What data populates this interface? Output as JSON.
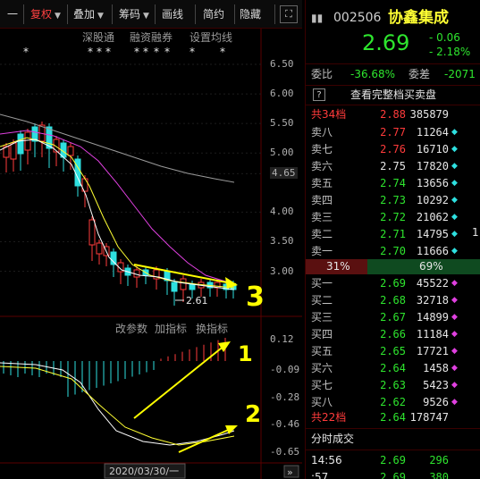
{
  "toolbar": {
    "items": [
      {
        "label": "一"
      },
      {
        "label": "复权"
      },
      {
        "label": "叠加"
      },
      {
        "label": "筹码"
      },
      {
        "label": "画线"
      },
      {
        "label": "简约"
      },
      {
        "label": "隐藏"
      }
    ],
    "expand_glyph": "⛶"
  },
  "chart_links": [
    "深股通",
    "融资融券",
    "设置均线"
  ],
  "y_axis": [
    "6.50",
    "6.00",
    "5.50",
    "5.00",
    "4.65",
    "4.00",
    "3.50",
    "3.00"
  ],
  "low_marker": "2.61",
  "indicator_bar": [
    "改参数",
    "加指标",
    "换指标"
  ],
  "macd_axis": [
    "0.12",
    "-0.09",
    "-0.28",
    "-0.46",
    "-0.65"
  ],
  "date_label": "2020/03/30/一",
  "scroll_glyph": "»",
  "annotations": [
    "3",
    "1",
    "2"
  ],
  "chart_data": {
    "type": "line",
    "title": "",
    "xlabel": "",
    "ylabel": "",
    "ylim": [
      2.6,
      6.5
    ],
    "y_ticks": [
      6.5,
      6.0,
      5.5,
      5.0,
      4.65,
      4.0,
      3.5,
      3.0
    ],
    "series": [],
    "macd_ylim": [
      -0.65,
      0.12
    ],
    "macd_ticks": [
      0.12,
      -0.09,
      -0.28,
      -0.46,
      -0.65
    ],
    "low_label": 2.61
  },
  "quote": {
    "code": "002506",
    "name": "协鑫集成",
    "price": "2.69",
    "change": "- 0.06",
    "change_pct": "- 2.18%",
    "weibi_label": "委比",
    "weibi": "-36.68%",
    "weicha_label": "委差",
    "weicha": "-2071",
    "help_glyph": "?",
    "full_book": "查看完整档买卖盘",
    "total_sell_label": "共34档",
    "total_sell_price": "2.88",
    "total_sell_vol": "385879",
    "sell": [
      {
        "label": "卖八",
        "price": "2.77",
        "vol": "11264",
        "mark": "◆",
        "color": "red"
      },
      {
        "label": "卖七",
        "price": "2.76",
        "vol": "16710",
        "mark": "◆",
        "color": "red"
      },
      {
        "label": "卖六",
        "price": "2.75",
        "vol": "17820",
        "mark": "◆",
        "color": "white"
      },
      {
        "label": "卖五",
        "price": "2.74",
        "vol": "13656",
        "mark": "◆",
        "color": "green"
      },
      {
        "label": "卖四",
        "price": "2.73",
        "vol": "10292",
        "mark": "◆",
        "color": "green"
      },
      {
        "label": "卖三",
        "price": "2.72",
        "vol": "21062",
        "mark": "◆",
        "color": "green"
      },
      {
        "label": "卖二",
        "price": "2.71",
        "vol": "14795",
        "mark": "◆",
        "color": "green"
      },
      {
        "label": "卖一",
        "price": "2.70",
        "vol": "11666",
        "mark": "◆",
        "color": "green"
      }
    ],
    "sell_extra": "1",
    "ratio_left": "31%",
    "ratio_right": "69%",
    "buy": [
      {
        "label": "买一",
        "price": "2.69",
        "vol": "45522",
        "mark": "◆",
        "color": "green"
      },
      {
        "label": "买二",
        "price": "2.68",
        "vol": "32718",
        "mark": "◆",
        "color": "green"
      },
      {
        "label": "买三",
        "price": "2.67",
        "vol": "14899",
        "mark": "◆",
        "color": "green"
      },
      {
        "label": "买四",
        "price": "2.66",
        "vol": "11184",
        "mark": "◆",
        "color": "green"
      },
      {
        "label": "买五",
        "price": "2.65",
        "vol": "17721",
        "mark": "◆",
        "color": "green"
      },
      {
        "label": "买六",
        "price": "2.64",
        "vol": "1458",
        "mark": "◆",
        "color": "green"
      },
      {
        "label": "买七",
        "price": "2.63",
        "vol": "5423",
        "mark": "◆",
        "color": "green"
      },
      {
        "label": "买八",
        "price": "2.62",
        "vol": "9526",
        "mark": "◆",
        "color": "green"
      }
    ],
    "total_buy_label": "共22档",
    "total_buy_price": "2.64",
    "total_buy_vol": "178747",
    "timeshare_title": "分时成交",
    "ticks": [
      {
        "time": "14:56",
        "price": "2.69",
        "vol": "296"
      },
      {
        "time": ":57",
        "price": "2.69",
        "vol": "380"
      }
    ]
  },
  "colors": {
    "up": "#ff3b3b",
    "down": "#2ee52e",
    "ma5": "#ffffff",
    "ma10": "#ffff33",
    "ma20": "#e040e0",
    "ma60": "#9a9a9a",
    "annotation": "#ffff00"
  }
}
